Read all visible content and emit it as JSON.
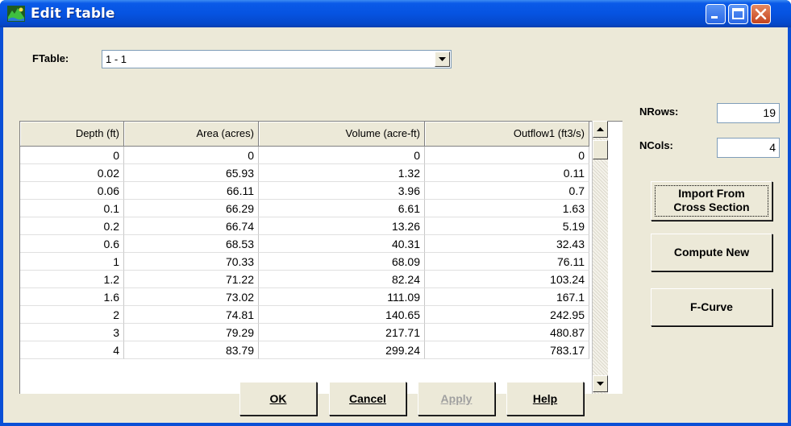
{
  "window": {
    "title": "Edit Ftable"
  },
  "ftable": {
    "label": "FTable:",
    "selected": "1 - 1"
  },
  "grid": {
    "columns": [
      "Depth (ft)",
      "Area (acres)",
      "Volume (acre-ft)",
      "Outflow1 (ft3/s)"
    ],
    "rows": [
      [
        "0",
        "0",
        "0",
        "0"
      ],
      [
        "0.02",
        "65.93",
        "1.32",
        "0.11"
      ],
      [
        "0.06",
        "66.11",
        "3.96",
        "0.7"
      ],
      [
        "0.1",
        "66.29",
        "6.61",
        "1.63"
      ],
      [
        "0.2",
        "66.74",
        "13.26",
        "5.19"
      ],
      [
        "0.6",
        "68.53",
        "40.31",
        "32.43"
      ],
      [
        "1",
        "70.33",
        "68.09",
        "76.11"
      ],
      [
        "1.2",
        "71.22",
        "82.24",
        "103.24"
      ],
      [
        "1.6",
        "73.02",
        "111.09",
        "167.1"
      ],
      [
        "2",
        "74.81",
        "140.65",
        "242.95"
      ],
      [
        "3",
        "79.29",
        "217.71",
        "480.87"
      ],
      [
        "4",
        "83.79",
        "299.24",
        "783.17"
      ]
    ]
  },
  "params": {
    "nrows_label": "NRows:",
    "nrows_value": "19",
    "ncols_label": "NCols:",
    "ncols_value": "4"
  },
  "side_buttons": {
    "import_line1": "Import From",
    "import_line2": "Cross Section",
    "compute": "Compute New",
    "fcurve": "F-Curve"
  },
  "bottom_buttons": {
    "ok": "OK",
    "cancel": "Cancel",
    "apply": "Apply",
    "help": "Help"
  },
  "icons": {
    "app": "ftable-app-icon",
    "minimize": "minimize-icon",
    "maximize": "maximize-icon",
    "close": "close-icon",
    "dropdown": "chevron-down-icon",
    "scroll_up": "scroll-up-icon",
    "scroll_down": "scroll-down-icon"
  }
}
